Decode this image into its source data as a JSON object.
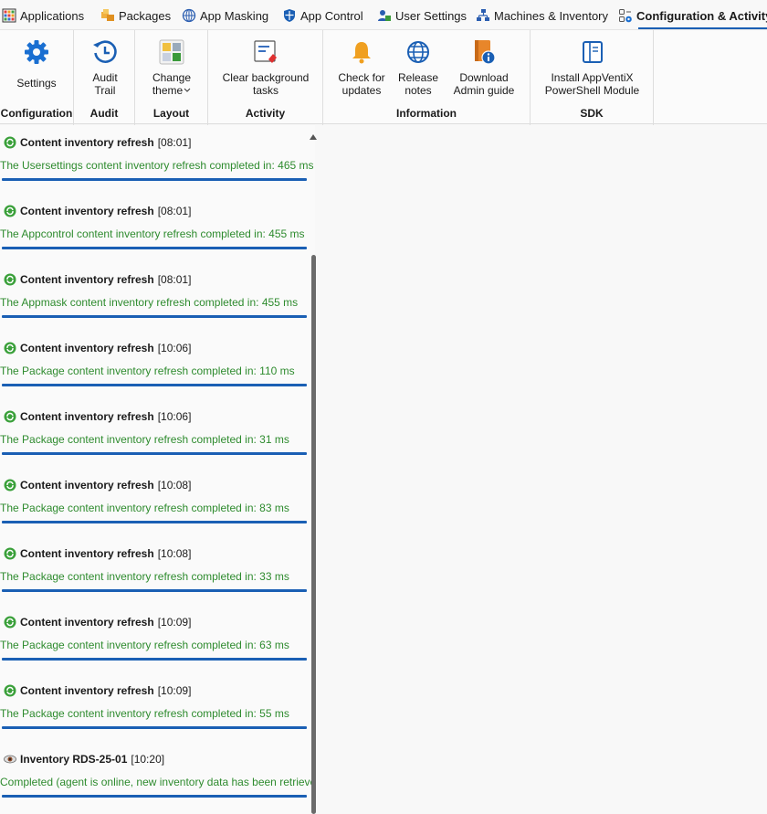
{
  "nav": {
    "tabs": [
      {
        "label": "Applications",
        "icon": "applications-grid-icon"
      },
      {
        "label": "Packages",
        "icon": "packages-icon"
      },
      {
        "label": "App Masking",
        "icon": "app-masking-icon"
      },
      {
        "label": "App Control",
        "icon": "shield-icon"
      },
      {
        "label": "User Settings",
        "icon": "user-settings-icon"
      },
      {
        "label": "Machines & Inventory",
        "icon": "machines-network-icon"
      },
      {
        "label": "Configuration & Activity",
        "icon": "configuration-icon",
        "active": true
      }
    ]
  },
  "ribbon": {
    "groups": {
      "configuration": "Configuration",
      "audit": "Audit",
      "layout": "Layout",
      "activity": "Activity",
      "information": "Information",
      "sdk": "SDK"
    },
    "buttons": {
      "settings": "Settings",
      "audit_trail_1": "Audit",
      "audit_trail_2": "Trail",
      "change_theme_1": "Change",
      "change_theme_2": "theme",
      "clear_tasks_1": "Clear background",
      "clear_tasks_2": "tasks",
      "check_updates_1": "Check for",
      "check_updates_2": "updates",
      "release_notes_1": "Release",
      "release_notes_2": "notes",
      "download_guide_1": "Download",
      "download_guide_2": "Admin guide",
      "install_ps_1": "Install AppVentiX",
      "install_ps_2": "PowerShell Module"
    }
  },
  "activity": [
    {
      "title": "Content inventory refresh",
      "time": "[08:01]",
      "message": "The Usersettings content inventory refresh completed in: 465 ms",
      "icon": "refresh-icon"
    },
    {
      "title": "Content inventory refresh",
      "time": "[08:01]",
      "message": "The Appcontrol content inventory refresh completed in: 455 ms",
      "icon": "refresh-icon"
    },
    {
      "title": "Content inventory refresh",
      "time": "[08:01]",
      "message": "The Appmask content inventory refresh completed in: 455 ms",
      "icon": "refresh-icon"
    },
    {
      "title": "Content inventory refresh",
      "time": "[10:06]",
      "message": "The Package content inventory refresh completed in: 110 ms",
      "icon": "refresh-icon"
    },
    {
      "title": "Content inventory refresh",
      "time": "[10:06]",
      "message": "The Package content inventory refresh completed in: 31 ms",
      "icon": "refresh-icon"
    },
    {
      "title": "Content inventory refresh",
      "time": "[10:08]",
      "message": "The Package content inventory refresh completed in: 83 ms",
      "icon": "refresh-icon"
    },
    {
      "title": "Content inventory refresh",
      "time": "[10:08]",
      "message": "The Package content inventory refresh completed in: 33 ms",
      "icon": "refresh-icon"
    },
    {
      "title": "Content inventory refresh",
      "time": "[10:09]",
      "message": "The Package content inventory refresh completed in: 63 ms",
      "icon": "refresh-icon"
    },
    {
      "title": "Content inventory refresh",
      "time": "[10:09]",
      "message": "The Package content inventory refresh completed in: 55 ms",
      "icon": "refresh-icon"
    },
    {
      "title": "Inventory RDS-25-01",
      "time": "[10:20]",
      "message": "Completed (agent is online, new inventory data has been retrieved)",
      "icon": "eye-icon"
    }
  ],
  "colors": {
    "accent": "#1a5fb4",
    "success_text": "#2e8b2e",
    "settings_icon": "#1a6fd1",
    "bell_icon": "#f0a020"
  }
}
